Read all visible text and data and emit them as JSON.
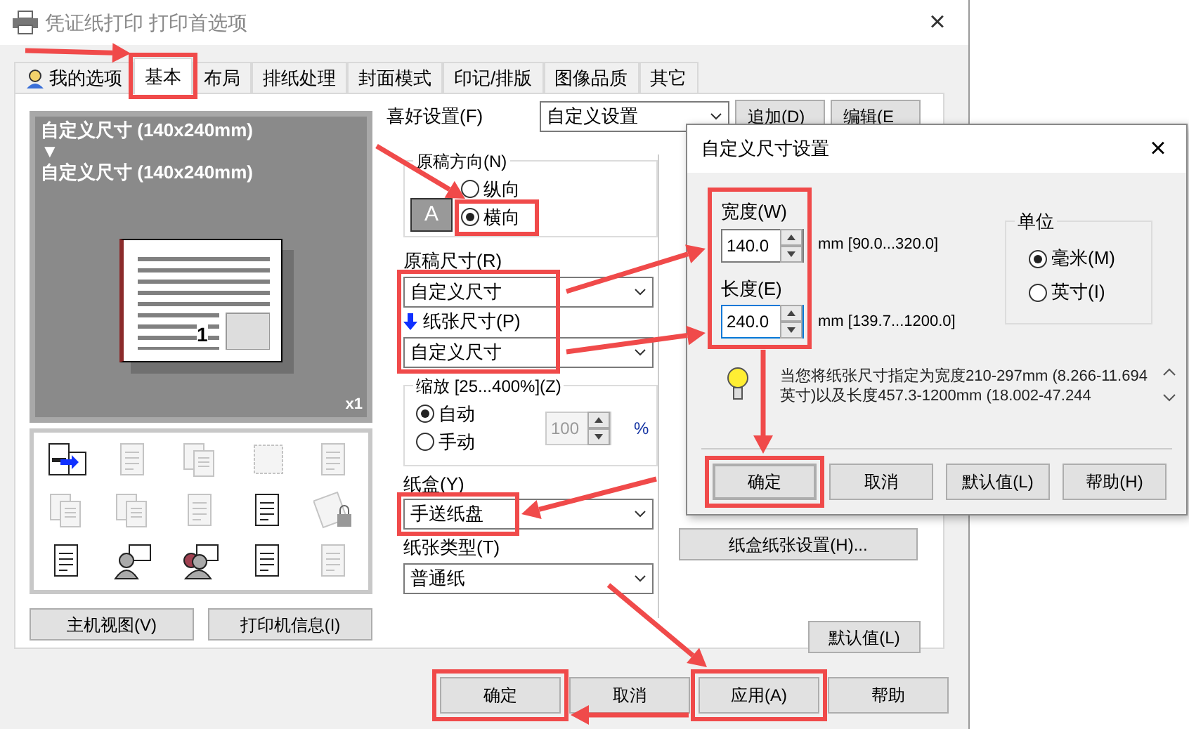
{
  "window": {
    "title": "凭证纸打印 打印首选项",
    "close": "×"
  },
  "tabs": [
    {
      "label": "我的选项",
      "selected": false,
      "kind": "person"
    },
    {
      "label": "基本",
      "selected": true
    },
    {
      "label": "布局",
      "selected": false
    },
    {
      "label": "排纸处理",
      "selected": false
    },
    {
      "label": "封面模式",
      "selected": false
    },
    {
      "label": "印记/排版",
      "selected": false
    },
    {
      "label": "图像品质",
      "selected": false
    },
    {
      "label": "其它",
      "selected": false
    }
  ],
  "preview": {
    "lines": [
      "自定义尺寸 (140x240mm)",
      "▼",
      "自定义尺寸 (140x240mm)"
    ],
    "page_number": "1",
    "copies": "x1"
  },
  "function_icons": [
    {
      "kind": "printer",
      "disabled": false
    },
    {
      "kind": "page",
      "disabled": true
    },
    {
      "kind": "pages",
      "disabled": true
    },
    {
      "kind": "blank",
      "disabled": true
    },
    {
      "kind": "page",
      "disabled": true
    },
    {
      "kind": "pages",
      "disabled": true
    },
    {
      "kind": "pages",
      "disabled": true
    },
    {
      "kind": "page",
      "disabled": true
    },
    {
      "kind": "page",
      "disabled": false
    },
    {
      "kind": "lock",
      "disabled": true
    },
    {
      "kind": "page",
      "disabled": false
    },
    {
      "kind": "person",
      "disabled": false
    },
    {
      "kind": "people",
      "disabled": false
    },
    {
      "kind": "page",
      "disabled": false
    },
    {
      "kind": "page",
      "disabled": true
    }
  ],
  "left_buttons": [
    "主机视图(V)",
    "打印机信息(I)"
  ],
  "favorites": {
    "label": "喜好设置(F)",
    "value": "自定义设置",
    "buttons": [
      "追加(D)",
      "编辑(E"
    ]
  },
  "orientation": {
    "label": "原稿方向(N)",
    "icon_letter": "A",
    "options": [
      {
        "label": "纵向",
        "selected": false
      },
      {
        "label": "横向",
        "selected": true
      }
    ]
  },
  "original_size": {
    "label": "原稿尺寸(R)",
    "value": "自定义尺寸"
  },
  "paper_size": {
    "label": "纸张尺寸(P)",
    "value": "自定义尺寸"
  },
  "zoom": {
    "label": "缩放 [25...400%](Z)",
    "options": [
      {
        "label": "自动",
        "selected": true
      },
      {
        "label": "手动",
        "selected": false
      }
    ],
    "value": "100",
    "disabled": true,
    "unit": "%"
  },
  "tray": {
    "label": "纸盒(Y)",
    "value": "手送纸盘"
  },
  "paper_type": {
    "label": "纸张类型(T)",
    "value": "普通纸"
  },
  "tray_settings_button": "纸盒纸张设置(H)...",
  "defaults_button": "默认值(L)",
  "footer_buttons": [
    "确定",
    "取消",
    "应用(A)",
    "帮助"
  ],
  "dialog": {
    "title": "自定义尺寸设置",
    "close": "×",
    "fields": [
      {
        "label": "宽度(W)",
        "value": "140.0",
        "range": "mm [90.0...320.0]"
      },
      {
        "label": "长度(E)",
        "value": "240.0",
        "range": "mm [139.7...1200.0]"
      }
    ],
    "unit": {
      "label": "单位",
      "options": [
        {
          "label": "毫米(M)",
          "selected": true
        },
        {
          "label": "英寸(I)",
          "selected": false
        }
      ]
    },
    "info": "当您将纸张尺寸指定为宽度210-297mm (8.266-11.694英寸)以及长度457.3-1200mm (18.002-47.244",
    "buttons": [
      "确定",
      "取消",
      "默认值(L)",
      "帮助(H)"
    ]
  }
}
